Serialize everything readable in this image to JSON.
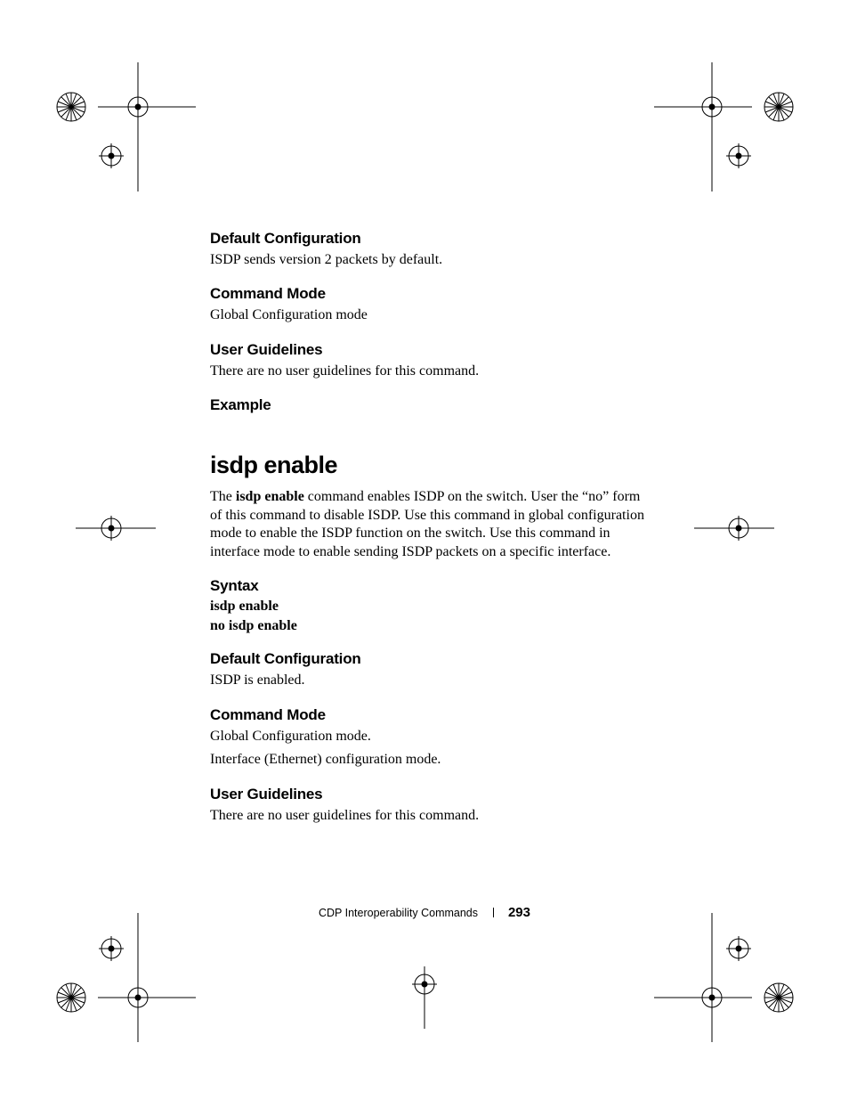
{
  "sections": {
    "s1": {
      "heading": "Default Configuration",
      "body": "ISDP sends version 2 packets by default."
    },
    "s2": {
      "heading": "Command Mode",
      "body": "Global Configuration mode"
    },
    "s3": {
      "heading": "User Guidelines",
      "body": "There are no user guidelines for this command."
    },
    "s4": {
      "heading": "Example"
    }
  },
  "command": {
    "title": "isdp enable",
    "desc_prefix": "The ",
    "desc_bold": "isdp enable",
    "desc_rest": " command enables ISDP on the switch. User the “no” form of this command to disable ISDP. Use this command in global configuration mode to enable the ISDP function on the switch. Use this command in interface mode to enable sending ISDP packets on a specific interface.",
    "syntax": {
      "heading": "Syntax",
      "line1": "isdp enable",
      "line2": "no isdp enable"
    },
    "def": {
      "heading": "Default Configuration",
      "body": "ISDP is enabled."
    },
    "mode": {
      "heading": "Command Mode",
      "l1": "Global Configuration mode.",
      "l2": "Interface (Ethernet) configuration mode."
    },
    "ug": {
      "heading": "User Guidelines",
      "body": "There are no user guidelines for this command."
    }
  },
  "footer": {
    "chapter": "CDP Interoperability Commands",
    "page": "293"
  }
}
